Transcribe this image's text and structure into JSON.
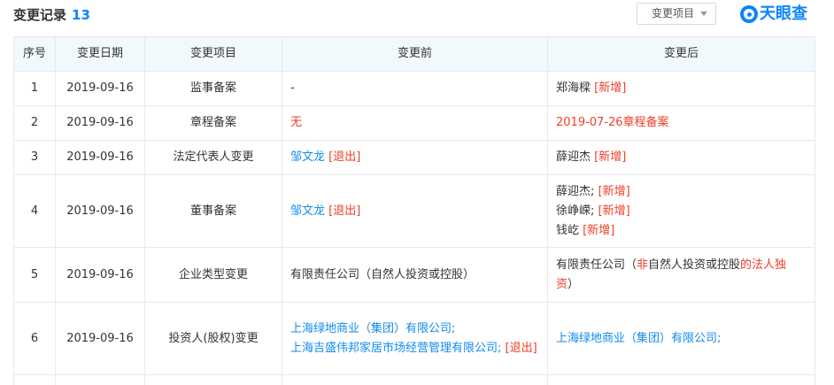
{
  "header": {
    "title": "变更记录",
    "count": "13",
    "filter_label": "变更项目",
    "brand": "天眼查"
  },
  "columns": [
    "序号",
    "变更日期",
    "变更项目",
    "变更前",
    "变更后"
  ],
  "rows": [
    {
      "index": "1",
      "date": "2019-09-16",
      "item": "监事备案",
      "before": [
        {
          "segments": [
            {
              "text": "-",
              "style": "plain"
            }
          ]
        }
      ],
      "after": [
        {
          "segments": [
            {
              "text": "郑海樑 ",
              "style": "plain"
            },
            {
              "text": "[新增]",
              "style": "tag"
            }
          ]
        }
      ]
    },
    {
      "index": "2",
      "date": "2019-09-16",
      "item": "章程备案",
      "before": [
        {
          "segments": [
            {
              "text": "无",
              "style": "red"
            }
          ]
        }
      ],
      "after": [
        {
          "segments": [
            {
              "text": "2019-07-26章程备案",
              "style": "red"
            }
          ]
        }
      ]
    },
    {
      "index": "3",
      "date": "2019-09-16",
      "item": "法定代表人变更",
      "before": [
        {
          "segments": [
            {
              "text": "邹文龙",
              "style": "link"
            },
            {
              "text": " [退出]",
              "style": "tag"
            }
          ]
        }
      ],
      "after": [
        {
          "segments": [
            {
              "text": "薛迎杰 ",
              "style": "plain"
            },
            {
              "text": "[新增]",
              "style": "tag"
            }
          ]
        }
      ]
    },
    {
      "index": "4",
      "date": "2019-09-16",
      "item": "董事备案",
      "before": [
        {
          "segments": [
            {
              "text": "邹文龙",
              "style": "link"
            },
            {
              "text": " [退出]",
              "style": "tag"
            }
          ]
        }
      ],
      "after": [
        {
          "segments": [
            {
              "text": "薛迎杰; ",
              "style": "plain"
            },
            {
              "text": "[新增]",
              "style": "tag"
            }
          ]
        },
        {
          "segments": [
            {
              "text": "徐峥嵘; ",
              "style": "plain"
            },
            {
              "text": "[新增]",
              "style": "tag"
            }
          ]
        },
        {
          "segments": [
            {
              "text": "钱屹 ",
              "style": "plain"
            },
            {
              "text": "[新增]",
              "style": "tag"
            }
          ]
        }
      ]
    },
    {
      "index": "5",
      "date": "2019-09-16",
      "item": "企业类型变更",
      "before": [
        {
          "segments": [
            {
              "text": "有限责任公司（自然人投资或控股）",
              "style": "plain"
            }
          ]
        }
      ],
      "after": [
        {
          "segments": [
            {
              "text": "有限责任公司（",
              "style": "plain"
            },
            {
              "text": "非",
              "style": "red"
            },
            {
              "text": "自然人投资或控股",
              "style": "plain"
            },
            {
              "text": "的法人独资",
              "style": "red"
            },
            {
              "text": "）",
              "style": "plain"
            }
          ]
        }
      ]
    },
    {
      "index": "6",
      "date": "2019-09-16",
      "item": "投资人(股权)变更",
      "before": [
        {
          "segments": [
            {
              "text": "上海绿地商业（集团）有限公司;",
              "style": "link"
            }
          ]
        },
        {
          "segments": [
            {
              "text": "上海吉盛伟邦家居市场经营管理有限公司;",
              "style": "link"
            },
            {
              "text": " [退出]",
              "style": "tag"
            }
          ]
        }
      ],
      "after": [
        {
          "segments": [
            {
              "text": "上海绿地商业（集团）有限公司;",
              "style": "link"
            }
          ]
        }
      ]
    },
    {
      "index": "",
      "date": "",
      "item": "",
      "before": [],
      "after": []
    }
  ]
}
